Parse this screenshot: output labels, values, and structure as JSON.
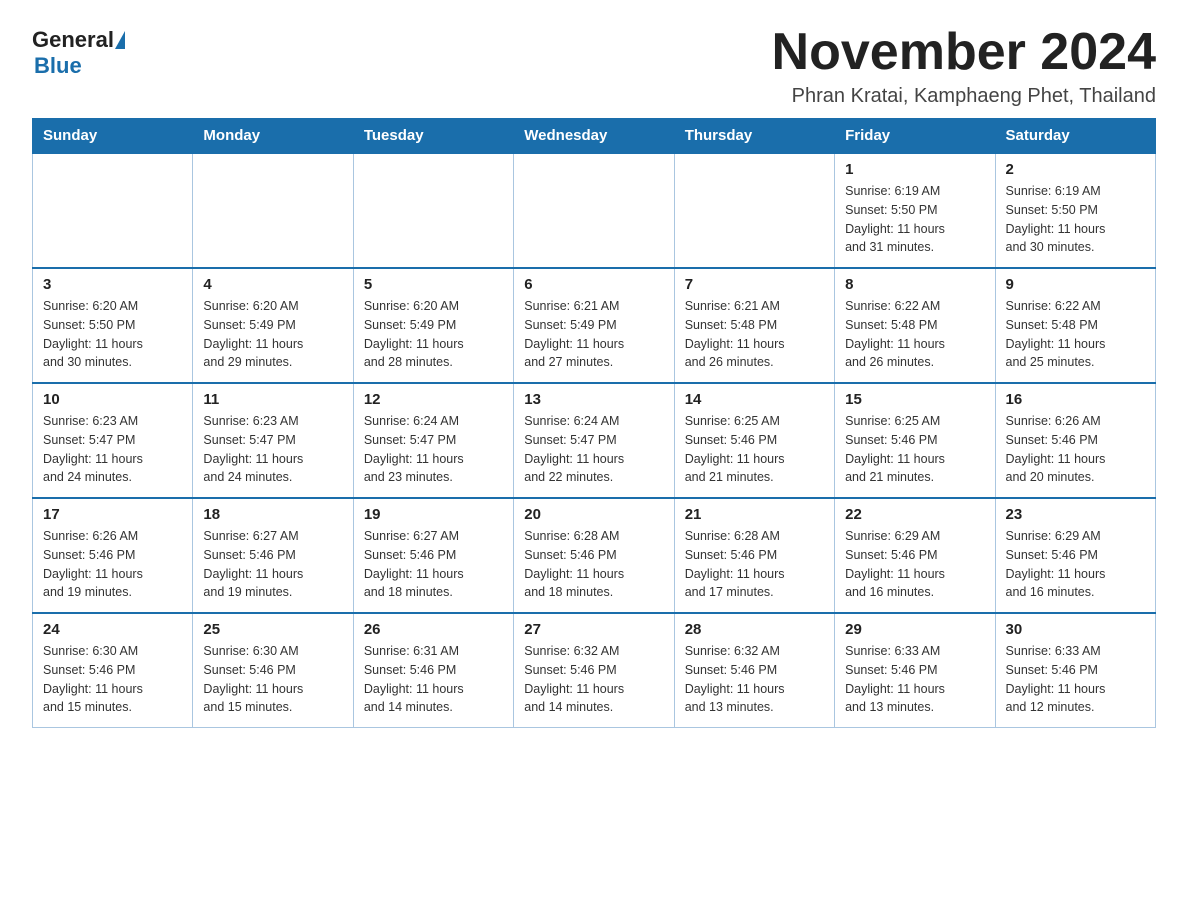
{
  "header": {
    "logo_general": "General",
    "logo_blue": "Blue",
    "month_title": "November 2024",
    "subtitle": "Phran Kratai, Kamphaeng Phet, Thailand"
  },
  "days_of_week": [
    "Sunday",
    "Monday",
    "Tuesday",
    "Wednesday",
    "Thursday",
    "Friday",
    "Saturday"
  ],
  "weeks": [
    [
      {
        "day": "",
        "info": ""
      },
      {
        "day": "",
        "info": ""
      },
      {
        "day": "",
        "info": ""
      },
      {
        "day": "",
        "info": ""
      },
      {
        "day": "",
        "info": ""
      },
      {
        "day": "1",
        "info": "Sunrise: 6:19 AM\nSunset: 5:50 PM\nDaylight: 11 hours\nand 31 minutes."
      },
      {
        "day": "2",
        "info": "Sunrise: 6:19 AM\nSunset: 5:50 PM\nDaylight: 11 hours\nand 30 minutes."
      }
    ],
    [
      {
        "day": "3",
        "info": "Sunrise: 6:20 AM\nSunset: 5:50 PM\nDaylight: 11 hours\nand 30 minutes."
      },
      {
        "day": "4",
        "info": "Sunrise: 6:20 AM\nSunset: 5:49 PM\nDaylight: 11 hours\nand 29 minutes."
      },
      {
        "day": "5",
        "info": "Sunrise: 6:20 AM\nSunset: 5:49 PM\nDaylight: 11 hours\nand 28 minutes."
      },
      {
        "day": "6",
        "info": "Sunrise: 6:21 AM\nSunset: 5:49 PM\nDaylight: 11 hours\nand 27 minutes."
      },
      {
        "day": "7",
        "info": "Sunrise: 6:21 AM\nSunset: 5:48 PM\nDaylight: 11 hours\nand 26 minutes."
      },
      {
        "day": "8",
        "info": "Sunrise: 6:22 AM\nSunset: 5:48 PM\nDaylight: 11 hours\nand 26 minutes."
      },
      {
        "day": "9",
        "info": "Sunrise: 6:22 AM\nSunset: 5:48 PM\nDaylight: 11 hours\nand 25 minutes."
      }
    ],
    [
      {
        "day": "10",
        "info": "Sunrise: 6:23 AM\nSunset: 5:47 PM\nDaylight: 11 hours\nand 24 minutes."
      },
      {
        "day": "11",
        "info": "Sunrise: 6:23 AM\nSunset: 5:47 PM\nDaylight: 11 hours\nand 24 minutes."
      },
      {
        "day": "12",
        "info": "Sunrise: 6:24 AM\nSunset: 5:47 PM\nDaylight: 11 hours\nand 23 minutes."
      },
      {
        "day": "13",
        "info": "Sunrise: 6:24 AM\nSunset: 5:47 PM\nDaylight: 11 hours\nand 22 minutes."
      },
      {
        "day": "14",
        "info": "Sunrise: 6:25 AM\nSunset: 5:46 PM\nDaylight: 11 hours\nand 21 minutes."
      },
      {
        "day": "15",
        "info": "Sunrise: 6:25 AM\nSunset: 5:46 PM\nDaylight: 11 hours\nand 21 minutes."
      },
      {
        "day": "16",
        "info": "Sunrise: 6:26 AM\nSunset: 5:46 PM\nDaylight: 11 hours\nand 20 minutes."
      }
    ],
    [
      {
        "day": "17",
        "info": "Sunrise: 6:26 AM\nSunset: 5:46 PM\nDaylight: 11 hours\nand 19 minutes."
      },
      {
        "day": "18",
        "info": "Sunrise: 6:27 AM\nSunset: 5:46 PM\nDaylight: 11 hours\nand 19 minutes."
      },
      {
        "day": "19",
        "info": "Sunrise: 6:27 AM\nSunset: 5:46 PM\nDaylight: 11 hours\nand 18 minutes."
      },
      {
        "day": "20",
        "info": "Sunrise: 6:28 AM\nSunset: 5:46 PM\nDaylight: 11 hours\nand 18 minutes."
      },
      {
        "day": "21",
        "info": "Sunrise: 6:28 AM\nSunset: 5:46 PM\nDaylight: 11 hours\nand 17 minutes."
      },
      {
        "day": "22",
        "info": "Sunrise: 6:29 AM\nSunset: 5:46 PM\nDaylight: 11 hours\nand 16 minutes."
      },
      {
        "day": "23",
        "info": "Sunrise: 6:29 AM\nSunset: 5:46 PM\nDaylight: 11 hours\nand 16 minutes."
      }
    ],
    [
      {
        "day": "24",
        "info": "Sunrise: 6:30 AM\nSunset: 5:46 PM\nDaylight: 11 hours\nand 15 minutes."
      },
      {
        "day": "25",
        "info": "Sunrise: 6:30 AM\nSunset: 5:46 PM\nDaylight: 11 hours\nand 15 minutes."
      },
      {
        "day": "26",
        "info": "Sunrise: 6:31 AM\nSunset: 5:46 PM\nDaylight: 11 hours\nand 14 minutes."
      },
      {
        "day": "27",
        "info": "Sunrise: 6:32 AM\nSunset: 5:46 PM\nDaylight: 11 hours\nand 14 minutes."
      },
      {
        "day": "28",
        "info": "Sunrise: 6:32 AM\nSunset: 5:46 PM\nDaylight: 11 hours\nand 13 minutes."
      },
      {
        "day": "29",
        "info": "Sunrise: 6:33 AM\nSunset: 5:46 PM\nDaylight: 11 hours\nand 13 minutes."
      },
      {
        "day": "30",
        "info": "Sunrise: 6:33 AM\nSunset: 5:46 PM\nDaylight: 11 hours\nand 12 minutes."
      }
    ]
  ]
}
